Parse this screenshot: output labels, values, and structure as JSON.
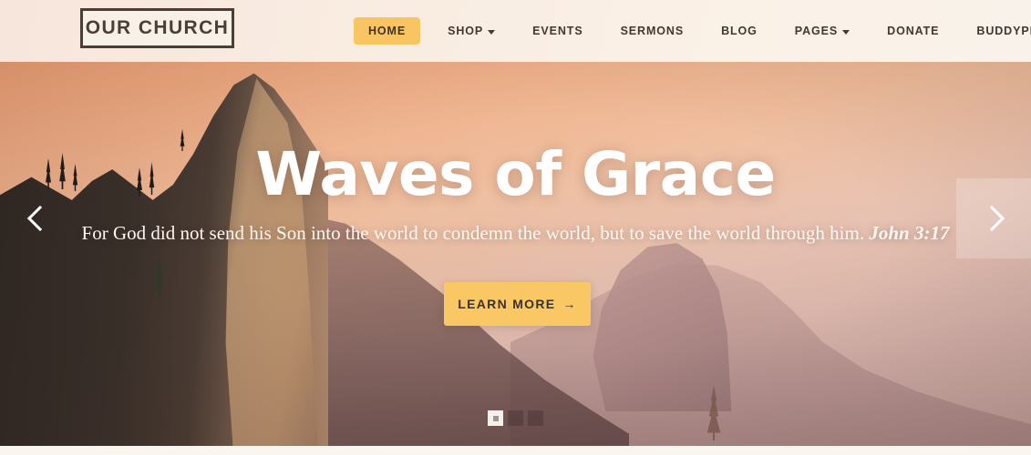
{
  "site": {
    "logo_text": "OUR CHURCH"
  },
  "nav": {
    "items": [
      {
        "label": "HOME",
        "active": true,
        "has_dropdown": false
      },
      {
        "label": "SHOP",
        "active": false,
        "has_dropdown": true
      },
      {
        "label": "EVENTS",
        "active": false,
        "has_dropdown": false
      },
      {
        "label": "SERMONS",
        "active": false,
        "has_dropdown": false
      },
      {
        "label": "BLOG",
        "active": false,
        "has_dropdown": false
      },
      {
        "label": "PAGES",
        "active": false,
        "has_dropdown": true
      },
      {
        "label": "DONATE",
        "active": false,
        "has_dropdown": false
      },
      {
        "label": "BUDDYPRESS",
        "active": false,
        "has_dropdown": true
      }
    ]
  },
  "hero": {
    "title": "Waves of Grace",
    "subtitle": "For God did not send his Son into the world to condemn the world, but to save the world through him.",
    "reference": "John 3:17",
    "cta_label": "LEARN MORE",
    "cta_arrow": "→",
    "prev_icon": "chevron-left-icon",
    "next_icon": "chevron-right-icon",
    "slides_total": 3,
    "active_slide": 1
  },
  "colors": {
    "accent": "#f9c563",
    "header_bg": "#f9ece1",
    "logo_border": "#4b3f35",
    "nav_text": "#41382f",
    "hero_text": "#ffffff"
  }
}
